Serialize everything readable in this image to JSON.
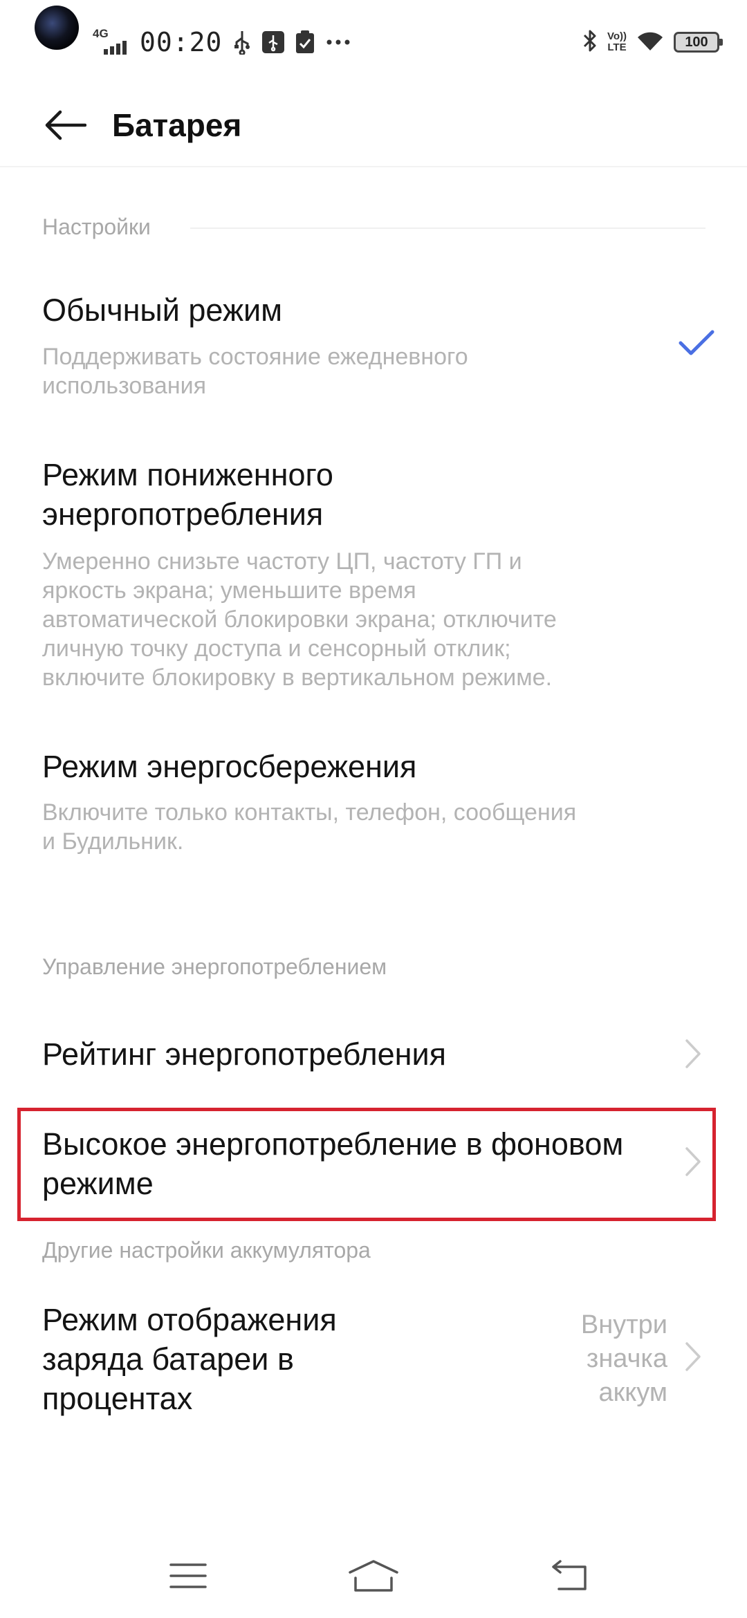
{
  "status_bar": {
    "network": "4G",
    "time": "00:20",
    "volte_line1": "Vo))",
    "volte_line2": "LTE",
    "battery": "100",
    "more_icon": "three-dots-icon"
  },
  "header": {
    "title": "Батарея"
  },
  "sections": {
    "settings_label": "Настройки",
    "power_management_label": "Управление энергопотреблением",
    "other_label": "Другие настройки аккумулятора"
  },
  "modes": {
    "normal": {
      "title": "Обычный режим",
      "desc_line1": "Поддерживать состояние ежедневного",
      "desc_line2": "использования",
      "selected": true
    },
    "low_power": {
      "title_line1": "Режим пониженного",
      "title_line2": "энергопотребления",
      "desc_line1": "Умеренно снизьте частоту ЦП, частоту ГП и",
      "desc_line2": "яркость экрана; уменьшите время",
      "desc_line3": "автоматической блокировки экрана; отключите",
      "desc_line4": "личную точку доступа и сенсорный отклик;",
      "desc_line5": "включите блокировку в вертикальном режиме."
    },
    "saving": {
      "title": "Режим энергосбережения",
      "desc_line1": "Включите только контакты, телефон, сообщения",
      "desc_line2": "и Будильник."
    }
  },
  "power_management": {
    "rating": "Рейтинг энергопотребления",
    "background_line1": "Высокое энергопотребление в фоновом",
    "background_line2": "режиме"
  },
  "battery_percent": {
    "title_line1": "Режим отображения",
    "title_line2": "заряда батареи в",
    "title_line3": "процентах",
    "value_line1": "Внутри",
    "value_line2": "значка",
    "value_line3": "аккум"
  },
  "colors": {
    "accent": "#4a6fe3",
    "highlight": "#d6232f",
    "secondary_text": "#b3b3b3"
  }
}
